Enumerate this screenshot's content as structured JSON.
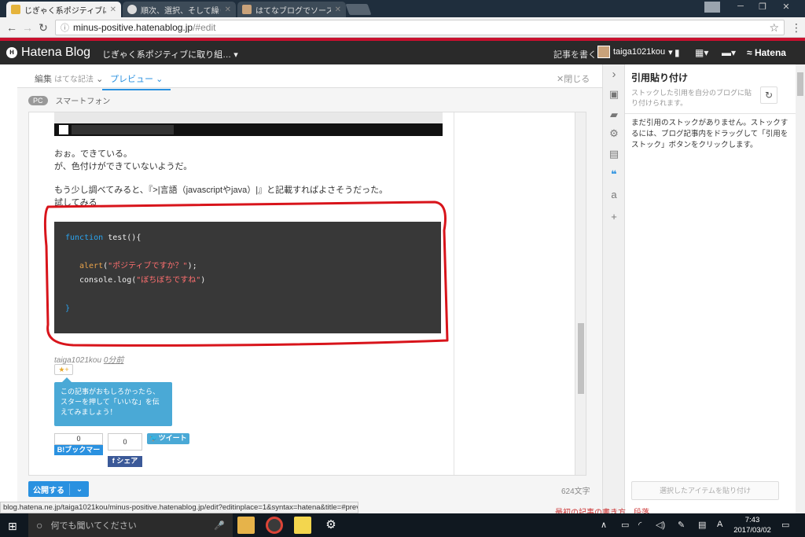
{
  "browser": {
    "tabs": [
      {
        "title": "じぎゃく系ポジティブに取り組",
        "active": true
      },
      {
        "title": "順次、選択、そして繰り返し",
        "active": false
      },
      {
        "title": "はてなブログでソースコードを綺",
        "active": false
      }
    ],
    "url_host": "minus-positive.hatenablog.jp",
    "url_path": "/#edit"
  },
  "hatena": {
    "logo": "Hatena Blog",
    "blog_name": "じぎゃく系ポジティブに取り組…",
    "write_label": "記事を書く",
    "username": "taiga1021kou",
    "brand": "Hatena"
  },
  "editor": {
    "tab_edit": "編集",
    "tab_edit_sub": "はてな記法",
    "tab_preview": "プレビュー",
    "close_label": "閉じる",
    "device_pc": "PC",
    "device_sp": "スマートフォン",
    "publish_label": "公開する",
    "char_count": "624文字"
  },
  "article": {
    "p1_line1": "おぉ。できている。",
    "p1_line2": "が、色付けができていないようだ。",
    "p2_line1": "もう少し調べてみると、『>|言語（javascriptやjava）|』と記載すればよさそうだった。",
    "p2_line2": "試してみる",
    "code": {
      "line1_kw": "function",
      "line1_rest": " test(){",
      "line3_fn": "alert",
      "line3_open": "(",
      "line3_str": "\"ポジティブですか？\"",
      "line3_close": ");",
      "line4_fn": "console.log(",
      "line4_str": "\"ぼちぼちですね\"",
      "line4_close": ")",
      "line6": "}"
    },
    "author": "taiga1021kou",
    "time": "0分前",
    "star_label": "★+",
    "tip": "この記事がおもしろかったら、スターを押して「いいな」を伝えてみましょう！",
    "bookmark_count": "0",
    "bookmark_label": "B!ブックマーク",
    "fb_count": "0",
    "fb_label": "シェア",
    "tweet_label": "ツイート"
  },
  "quote_panel": {
    "title": "引用貼り付け",
    "description": "ストックした引用を自分のブログに貼り付けられます。",
    "empty_message": "まだ引用のストックがありません。ストックするには、ブログ記事内をドラッグして「引用をストック」ボタンをクリックします。",
    "paste_button": "選択したアイテムを貼り付け"
  },
  "status_url": "blog.hatena.ne.jp/taiga1021kou/minus-positive.hatenablog.jp/edit?editinplace=1&syntax=hatena&title=#preview",
  "hidden_hint": "最初の記事の書き方　段落",
  "taskbar": {
    "search_placeholder": "何でも聞いてください",
    "time": "7:43",
    "date": "2017/03/02"
  },
  "colors": {
    "accent": "#2a91e0",
    "header_bg": "#2a2a2a",
    "header_stripe": "#c8102e",
    "code_bg": "#383838",
    "annotation_red": "#d8141b"
  }
}
